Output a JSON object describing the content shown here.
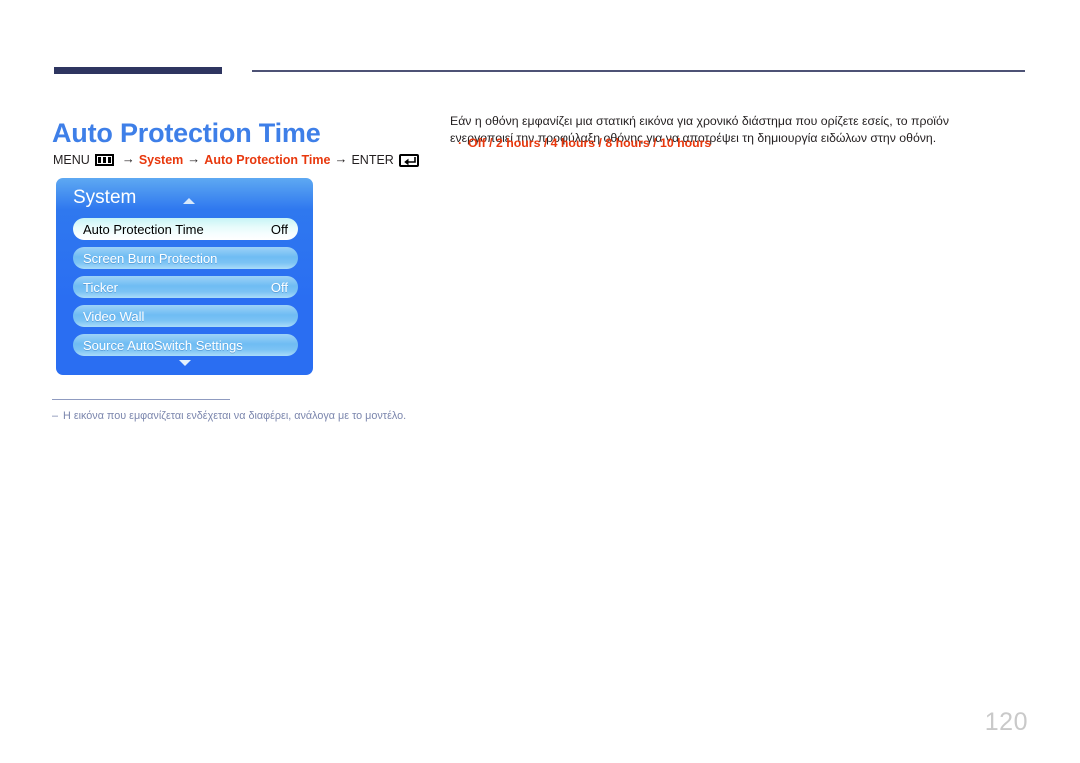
{
  "header": {
    "accent_bar_color": "#2e3560",
    "rule_color": "#4d5275"
  },
  "page": {
    "title": "Auto Protection Time",
    "title_color": "#3e7fe8",
    "number": "120"
  },
  "menu_path": {
    "menu_label": "MENU",
    "menu_icon": "menu-grid-icon",
    "arrow": "→",
    "step_system": "System",
    "step_feature": "Auto Protection Time",
    "enter_label": "ENTER",
    "enter_icon": "enter-return-icon",
    "accent_color": "#e8380d"
  },
  "osd": {
    "title": "System",
    "scroll_up_icon": "caret-up-icon",
    "scroll_down_icon": "caret-down-icon",
    "rows": [
      {
        "label": "Auto Protection Time",
        "value": "Off",
        "selected": true
      },
      {
        "label": "Screen Burn Protection",
        "value": "",
        "selected": false
      },
      {
        "label": "Ticker",
        "value": "Off",
        "selected": false
      },
      {
        "label": "Video Wall",
        "value": "",
        "selected": false
      },
      {
        "label": "Source AutoSwitch Settings",
        "value": "",
        "selected": false
      }
    ]
  },
  "description": {
    "paragraph": "Εάν η οθόνη εμφανίζει μια στατική εικόνα για χρονικό διάστημα που ορίζετε εσείς, το προϊόν ενεργοποιεί την προφύλαξη οθόνης για να αποτρέψει τη δημιουργία ειδώλων στην οθόνη.",
    "bullet_marker": "·",
    "options": "Off / 2 hours / 4 hours / 8 hours / 10 hours"
  },
  "footnote": {
    "dash": "‒",
    "text": "Η εικόνα που εμφανίζεται ενδέχεται να διαφέρει, ανάλογα με το μοντέλο.",
    "color": "#7b86ad"
  }
}
